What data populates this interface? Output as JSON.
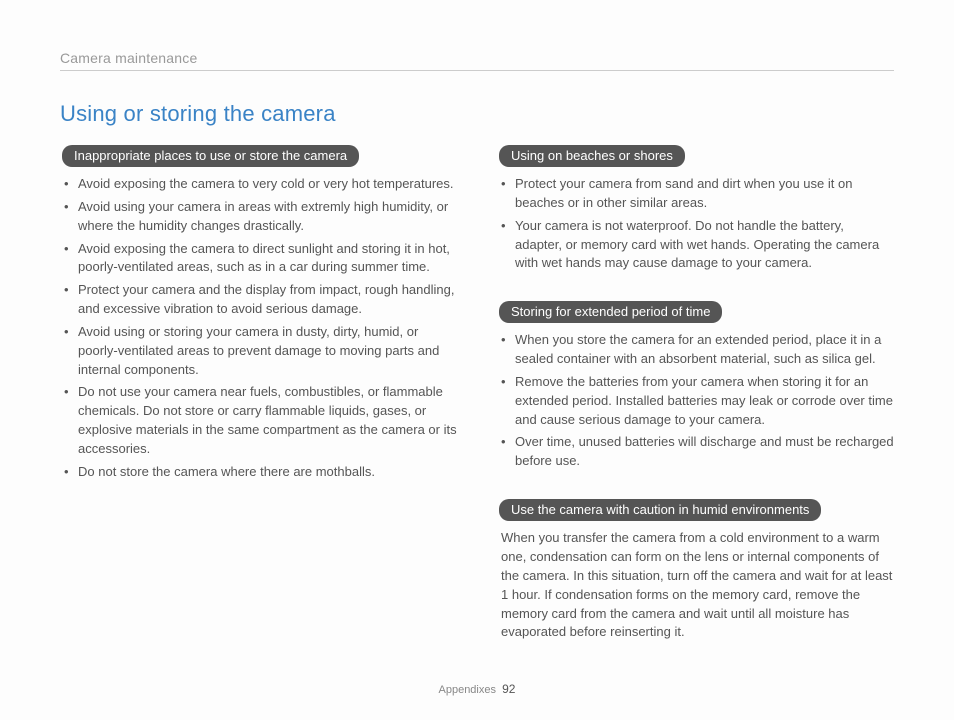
{
  "header": {
    "section": "Camera maintenance"
  },
  "title": "Using or storing the camera",
  "left": {
    "sec1": {
      "heading": "Inappropriate places to use or store the camera",
      "items": [
        "Avoid exposing the camera to very cold or very hot temperatures.",
        "Avoid using your camera in areas with extremly high humidity, or where the humidity changes drastically.",
        "Avoid exposing the camera to direct sunlight and storing it in hot, poorly-ventilated areas, such as in a car during summer time.",
        "Protect your camera and the display from impact, rough handling, and excessive vibration to avoid serious damage.",
        "Avoid using or storing your camera in dusty, dirty, humid, or poorly-ventilated areas to prevent damage to moving parts and internal components.",
        "Do not use your camera near fuels, combustibles, or flammable chemicals. Do not store or carry flammable liquids, gases, or explosive materials in the same compartment as the camera or its accessories.",
        "Do not store the camera where there are mothballs."
      ]
    }
  },
  "right": {
    "sec1": {
      "heading": "Using on beaches or shores",
      "items": [
        "Protect your camera from sand and dirt when you use it on beaches or in other similar areas.",
        "Your camera is not waterproof. Do not handle the battery, adapter, or memory card with wet hands. Operating the camera with wet hands may cause damage to your camera."
      ]
    },
    "sec2": {
      "heading": "Storing for extended period of time",
      "items": [
        "When you store the camera for an extended period, place it in a sealed container with an absorbent material, such as silica gel.",
        "Remove the batteries from your camera when storing it for an extended period. Installed batteries may leak or corrode over time and cause serious damage to your camera.",
        "Over time, unused batteries will discharge and must be recharged before use."
      ]
    },
    "sec3": {
      "heading": "Use the camera with caution in humid environments",
      "para": "When you transfer the camera from a cold environment to a warm one, condensation can form on the lens or internal components of the camera. In this situation, turn off the camera and wait for at least 1 hour. If condensation forms on the memory card, remove the memory card from the camera and wait until all moisture has evaporated before reinserting it."
    }
  },
  "footer": {
    "label": "Appendixes",
    "page": "92"
  }
}
